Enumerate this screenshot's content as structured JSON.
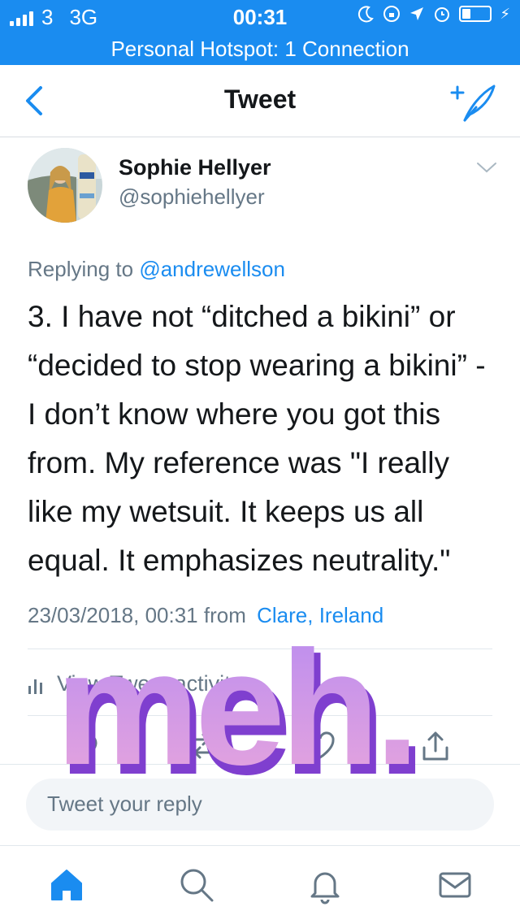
{
  "status_bar": {
    "carrier": "3",
    "network": "3G",
    "time": "00:31",
    "bolt": "⚡"
  },
  "hotspot_banner": "Personal Hotspot: 1 Connection",
  "nav": {
    "title": "Tweet",
    "back_icon": "chevron-left-icon",
    "compose_icon": "compose-tweet-icon"
  },
  "tweet": {
    "author_name": "Sophie Hellyer",
    "author_handle": "@sophiehellyer",
    "replying_prefix": "Replying to",
    "replying_to": "@andrewellson",
    "text": "3.  I have not “ditched a bikini” or “decided to stop wearing a bikini” - I don’t know where you got this from. My reference was \"I really like my wetsuit. It keeps us all equal. It emphasizes neutrality.\"",
    "timestamp": "23/03/2018, 00:31 from",
    "location": "Clare, Ireland"
  },
  "activity_label": "View Tweet activity",
  "reply_placeholder": "Tweet your reply",
  "overlay_text": "meh.",
  "colors": {
    "accent": "#1a8cf0",
    "secondary_text": "#657786",
    "overlay_purple": "#9b5fe0",
    "overlay_pink": "#e8a0d8"
  },
  "tabs": [
    "home-icon",
    "search-icon",
    "notifications-icon",
    "messages-icon"
  ]
}
